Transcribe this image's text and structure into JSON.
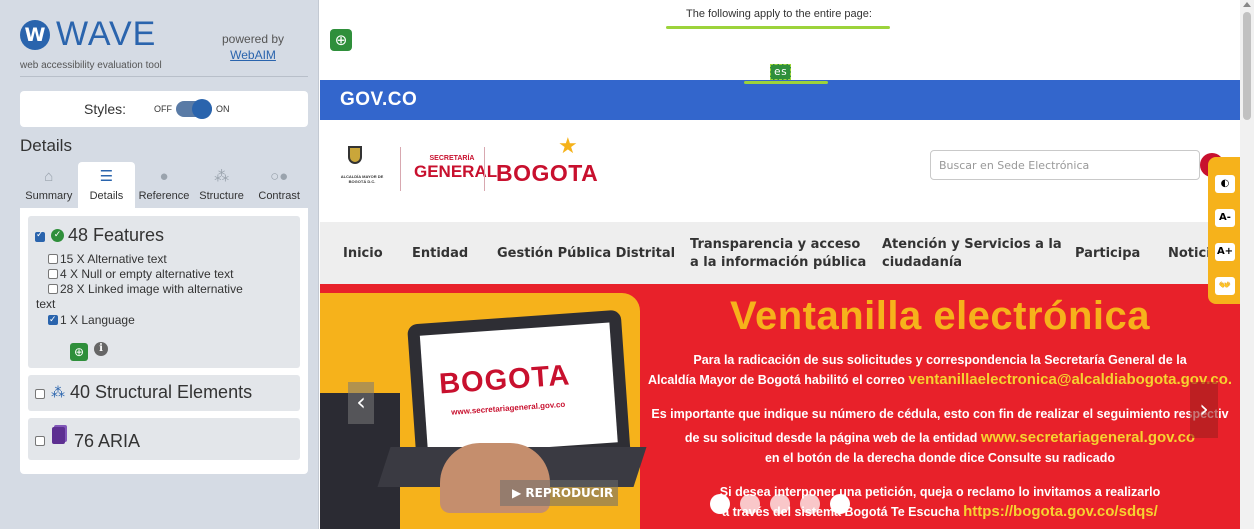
{
  "wave": {
    "logo_letter": "W",
    "title": "WAVE",
    "subtitle": "web accessibility evaluation tool",
    "powered_by": "powered by",
    "powered_link": "WebAIM",
    "styles": {
      "label": "Styles:",
      "off": "OFF",
      "on": "ON",
      "state": "on"
    },
    "details_title": "Details",
    "tabs": [
      {
        "label": "Summary",
        "icon": "home-icon",
        "glyph": "⌂",
        "active": false
      },
      {
        "label": "Details",
        "icon": "list-icon",
        "glyph": "☰",
        "active": true
      },
      {
        "label": "Reference",
        "icon": "info-icon",
        "glyph": "●",
        "active": false
      },
      {
        "label": "Structure",
        "icon": "structure-icon",
        "glyph": "⁂",
        "active": false
      },
      {
        "label": "Contrast",
        "icon": "contrast-icon",
        "glyph": "○●",
        "active": false
      }
    ],
    "features": {
      "title": "48 Features",
      "items": [
        {
          "label": "15 X Alternative text",
          "checked": false
        },
        {
          "label": "4 X Null or empty alternative text",
          "checked": false
        },
        {
          "label": "28 X Linked image with alternative",
          "label_cont": "text",
          "checked": false
        },
        {
          "label": "1 X Language",
          "checked": true
        }
      ]
    },
    "structural": {
      "title": "40 Structural Elements"
    },
    "aria": {
      "title": "76 ARIA"
    }
  },
  "site": {
    "wave_notice": "The following apply to the entire page:",
    "lang_tag": "es",
    "gov_logo": "GOV.CO",
    "escudo_text": "ALCALDÍA MAYOR DE BOGOTÁ D.C.",
    "secretaria_small": "SECRETARÍA",
    "secretaria_big": "GENERAL",
    "bogota_logo": "BOGOTA",
    "search_placeholder": "Buscar en Sede Electrónica",
    "nav": [
      {
        "line1": "Inicio"
      },
      {
        "line1": "Entidad"
      },
      {
        "line1": "Gestión Pública Distrital"
      },
      {
        "line1": "Transparencia y acceso",
        "line2": "a la información pública"
      },
      {
        "line1": "Atención y Servicios a la",
        "line2": "ciudadanía"
      },
      {
        "line1": "Participa"
      },
      {
        "line1": "Notici"
      }
    ],
    "hero": {
      "title": "Ventanilla electrónica",
      "p1": "Para la radicación de sus solicitudes y correspondencia la Secretaría General de la",
      "p2a": "Alcaldía Mayor de Bogotá habilitó el correo ",
      "p2b": "ventanillaelectronica@alcaldiabogota.gov.co.",
      "p3": "Es importante que indique su número de cédula, esto con fin de realizar el seguimiento respectiv",
      "p4a": "de su solicitud desde la página web de la entidad ",
      "p4b": "www.secretariageneral.gov.co",
      "p5": "en el botón de la derecha donde dice Consulte su radicado",
      "p6": "Si desea interponer una petición, queja o reclamo lo invitamos a realizarlo",
      "p7a": "a través del sistema Bogotá Te Escucha ",
      "p7b": "https://bogota.gov.co/sdqs/",
      "laptop_logo": "BOGOTA",
      "laptop_url": "www.secretariageneral.gov.co",
      "play_label": "REPRODUCIR",
      "dots": 5
    },
    "a11y": [
      {
        "label": "◐",
        "icon": "contrast-icon"
      },
      {
        "label": "A-",
        "icon": "decrease-font-icon"
      },
      {
        "label": "A+",
        "icon": "increase-font-icon"
      },
      {
        "label": "👐",
        "icon": "sign-language-icon"
      }
    ]
  }
}
